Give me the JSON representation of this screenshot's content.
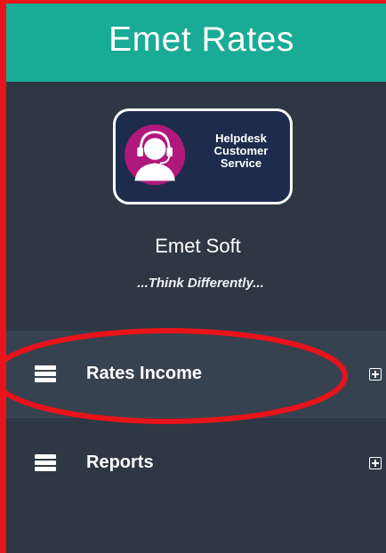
{
  "app": {
    "title": "Emet Rates"
  },
  "profile": {
    "logo_text": [
      "Helpdesk",
      "Customer",
      "Service"
    ],
    "name": "Emet Soft",
    "tagline": "...Think Differently..."
  },
  "menu": {
    "items": [
      {
        "label": "Rates Income",
        "icon": "server-stack-icon",
        "expand_icon": "plus-square-icon"
      },
      {
        "label": "Reports",
        "icon": "server-stack-icon",
        "expand_icon": "plus-square-icon"
      }
    ]
  },
  "colors": {
    "header_bg": "#1aab96",
    "sidebar_bg": "#2d3844",
    "logo_bg": "#1d2c4c",
    "avatar_purple": "#b0187c",
    "annotation_red": "#e8131b"
  }
}
